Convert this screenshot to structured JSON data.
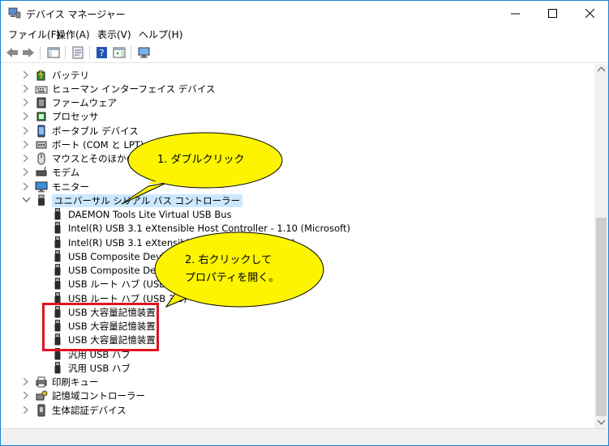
{
  "window": {
    "title": "デバイス マネージャー"
  },
  "menu": [
    "ファイル(F)",
    "操作(A)",
    "表示(V)",
    "ヘルプ(H)"
  ],
  "tree": [
    {
      "label": "バッテリ",
      "icon": "battery-icon",
      "level": 1,
      "expanded": false
    },
    {
      "label": "ヒューマン インターフェイス デバイス",
      "icon": "hid-icon",
      "level": 1,
      "expanded": false
    },
    {
      "label": "ファームウェア",
      "icon": "firmware-icon",
      "level": 1,
      "expanded": false
    },
    {
      "label": "プロセッサ",
      "icon": "processor-icon",
      "level": 1,
      "expanded": false
    },
    {
      "label": "ポータブル デバイス",
      "icon": "portable-device-icon",
      "level": 1,
      "expanded": false
    },
    {
      "label": "ポート (COM と LPT)",
      "icon": "port-icon",
      "level": 1,
      "expanded": false
    },
    {
      "label": "マウスとそのほかのポ",
      "icon": "mouse-icon",
      "level": 1,
      "expanded": false
    },
    {
      "label": "モデム",
      "icon": "modem-icon",
      "level": 1,
      "expanded": false
    },
    {
      "label": "モニター",
      "icon": "monitor-icon",
      "level": 1,
      "expanded": false
    },
    {
      "label": "ユニバーサル シリアル バス コントローラー",
      "icon": "usb-controller-icon",
      "level": 1,
      "expanded": true,
      "selected": true
    },
    {
      "label": "DAEMON Tools Lite Virtual USB Bus",
      "icon": "usb-plug-icon",
      "level": 2
    },
    {
      "label": "Intel(R) USB 3.1 eXtensible Host Controller - 1.10 (Microsoft)",
      "icon": "usb-plug-icon",
      "level": 2
    },
    {
      "label": "Intel(R) USB 3.1 eXtensible Ho",
      "tail": "t)",
      "icon": "usb-plug-icon",
      "level": 2
    },
    {
      "label": "USB Composite Device",
      "icon": "usb-plug-icon",
      "level": 2
    },
    {
      "label": "USB Composite Device",
      "icon": "usb-plug-icon",
      "level": 2
    },
    {
      "label": "USB ルート ハブ (USB 3.0)",
      "icon": "usb-plug-icon",
      "level": 2
    },
    {
      "label": "USB ルート ハブ (USB 3.0)",
      "icon": "usb-plug-icon",
      "level": 2
    },
    {
      "label": "USB 大容量記憶装置",
      "icon": "usb-plug-icon",
      "level": 2
    },
    {
      "label": "USB 大容量記憶装置",
      "icon": "usb-plug-icon",
      "level": 2
    },
    {
      "label": "USB 大容量記憶装置",
      "icon": "usb-plug-icon",
      "level": 2
    },
    {
      "label": "汎用 USB ハブ",
      "icon": "usb-plug-icon",
      "level": 2
    },
    {
      "label": "汎用 USB ハブ",
      "icon": "usb-plug-icon",
      "level": 2
    },
    {
      "label": "印刷キュー",
      "icon": "print-queue-icon",
      "level": 1,
      "expanded": false
    },
    {
      "label": "記憶域コントローラー",
      "icon": "storage-controller-icon",
      "level": 1,
      "expanded": false
    },
    {
      "label": "生体認証デバイス",
      "icon": "biometric-icon",
      "level": 1,
      "expanded": false
    }
  ],
  "callouts": {
    "c1": "1. ダブルクリック",
    "c2_line1": "2. 右クリックして",
    "c2_line2": "プロパティを開く。"
  },
  "colors": {
    "highlight": "#e0141e",
    "bubble_fill": "#fcf400",
    "selection": "#cce8ff"
  }
}
